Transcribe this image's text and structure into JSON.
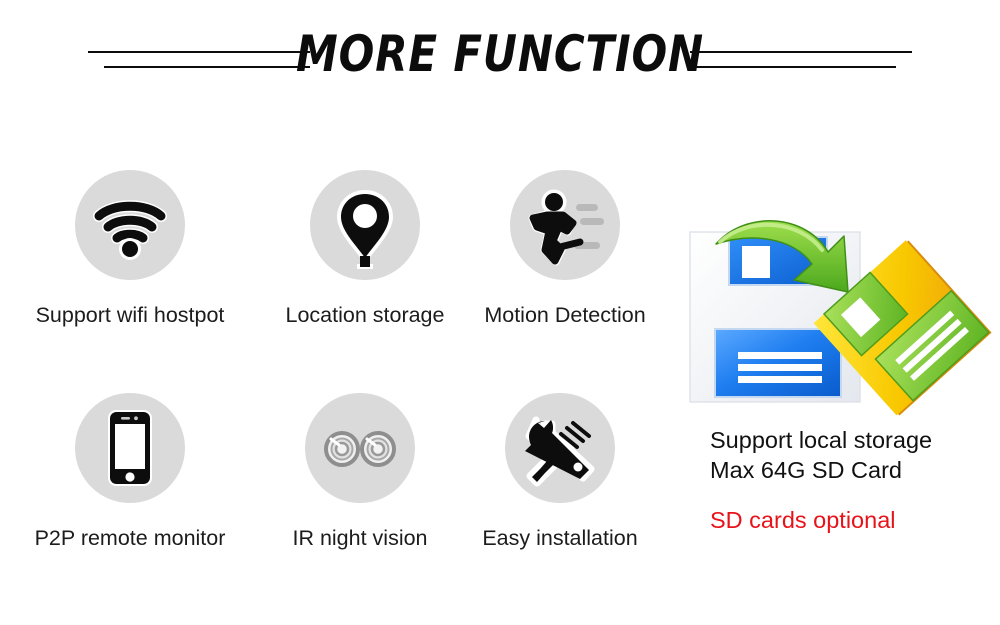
{
  "header": {
    "title": "MORE FUNCTION",
    "rule_color": "#0c0c0c"
  },
  "features": [
    {
      "id": "wifi",
      "icon": "wifi-icon",
      "label": "Support wifi hostpot"
    },
    {
      "id": "location",
      "icon": "map-pin-icon",
      "label": "Location storage"
    },
    {
      "id": "motion",
      "icon": "running-person-icon",
      "label": "Motion Detection"
    },
    {
      "id": "p2p",
      "icon": "smartphone-icon",
      "label": "P2P remote monitor"
    },
    {
      "id": "ir",
      "icon": "ir-led-lenses-icon",
      "label": "IR night vision"
    },
    {
      "id": "install",
      "icon": "wrench-screwdriver-icon",
      "label": "Easy installation"
    }
  ],
  "storage": {
    "icon": "save-to-sd-card-illustration",
    "line1": "Support local storage",
    "line2": "Max 64G SD Card",
    "note": "SD cards optional",
    "note_color": "#e8131a"
  },
  "colors": {
    "disc_gray": "#dadada",
    "icon_black": "#0d0d0d",
    "blue_disk": "#1f7ef0",
    "yellow_disk": "#f5c400",
    "green_panel": "#78c832",
    "green_arrow": "#63bf2a"
  }
}
